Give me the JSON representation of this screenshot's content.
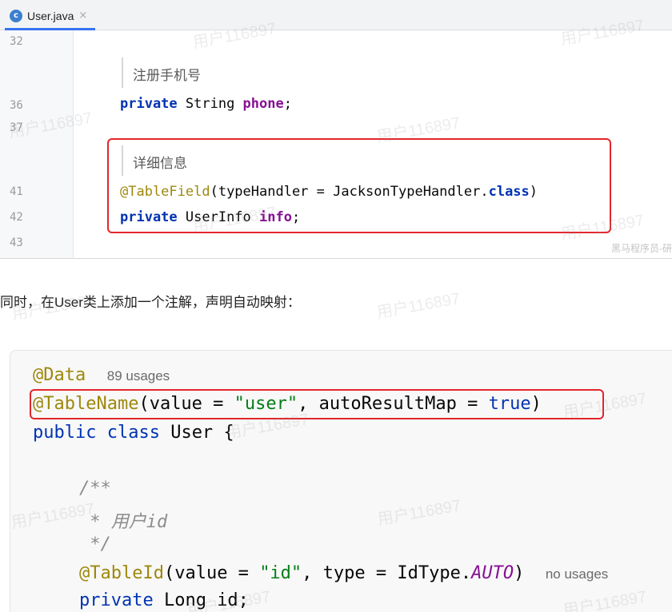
{
  "editor_top": {
    "tab": {
      "icon_letter": "c",
      "label": "User.java",
      "close": "×"
    },
    "lines": {
      "l32": "32",
      "l36": "36",
      "l37": "37",
      "l41": "41",
      "l42": "42",
      "l43": "43"
    },
    "doc_phone": "注册手机号",
    "phone_line": {
      "kw": "private",
      "type": " String ",
      "name": "phone",
      "end": ";"
    },
    "doc_info": "详细信息",
    "annotation_line": {
      "ann": "@TableField",
      "open": "(typeHandler = JacksonTypeHandler.",
      "kw": "class",
      "close": ")"
    },
    "info_line": {
      "kw": "private",
      "type": " UserInfo ",
      "name": "info",
      "end": ";"
    },
    "watermark": "用户116897",
    "corner_watermark": "黑马程序员-研"
  },
  "article": {
    "text": "同时，在User类上添加一个注解，声明自动映射："
  },
  "editor_bottom": {
    "data_ann": "@Data",
    "data_usages": "89 usages",
    "tablename": {
      "ann": "@TableName",
      "p1": "(value = ",
      "s1": "\"user\"",
      "p2": ", autoResultMap = ",
      "kw": "true",
      "p3": ")"
    },
    "class_line": {
      "kw": "public class",
      "rest": " User {"
    },
    "comment_open": "/**",
    "comment_mid": " * 用户id",
    "comment_close": " */",
    "tableid": {
      "ann": "@TableId",
      "p1": "(value = ",
      "s1": "\"id\"",
      "p2": ", type = IdType.",
      "const": "AUTO",
      "p3": ")",
      "usages": "no usages"
    },
    "id_line": {
      "kw": "private",
      "rest": " Long id;"
    }
  },
  "colors": {
    "highlight_box": "#e2262c",
    "keyword": "#0033b3",
    "annotation": "#9e880d",
    "string": "#067d17",
    "field": "#871094",
    "tab_underline": "#3574f0"
  }
}
